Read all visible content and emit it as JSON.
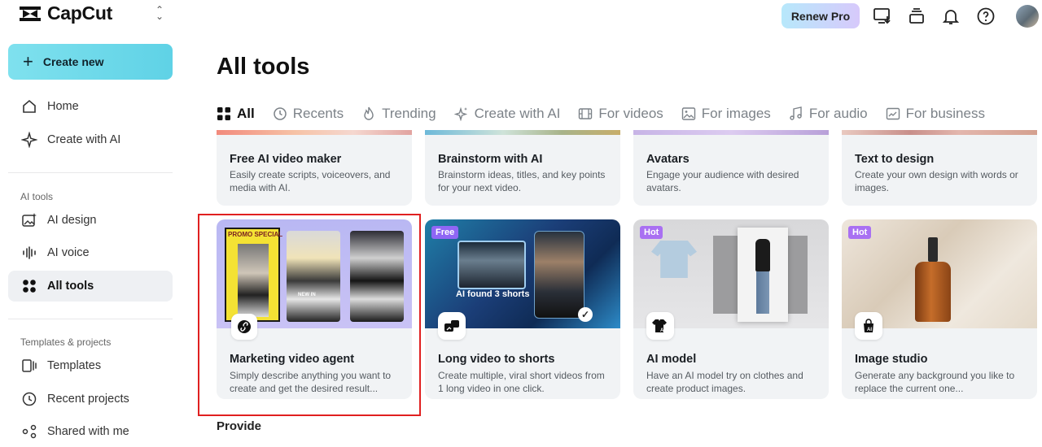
{
  "app": {
    "name": "CapCut"
  },
  "sidebar": {
    "create_label": "Create new",
    "nav": [
      {
        "label": "Home",
        "icon": "home-icon"
      },
      {
        "label": "Create with AI",
        "icon": "sparkle-icon"
      }
    ],
    "ai_tools_label": "AI tools",
    "ai_items": [
      {
        "label": "AI design",
        "icon": "image-sparkle-icon"
      },
      {
        "label": "AI voice",
        "icon": "waveform-icon"
      },
      {
        "label": "All tools",
        "icon": "grid-icon",
        "active": true
      }
    ],
    "templates_label": "Templates & projects",
    "project_items": [
      {
        "label": "Templates",
        "icon": "template-icon"
      },
      {
        "label": "Recent projects",
        "icon": "clock-icon"
      },
      {
        "label": "Shared with me",
        "icon": "share-icon"
      }
    ]
  },
  "topbar": {
    "renew_label": "Renew Pro"
  },
  "main": {
    "title": "All tools",
    "tabs": [
      {
        "label": "All",
        "icon": "grid-icon",
        "active": true
      },
      {
        "label": "Recents",
        "icon": "clock-icon"
      },
      {
        "label": "Trending",
        "icon": "flame-icon"
      },
      {
        "label": "Create with AI",
        "icon": "sparkle-icon"
      },
      {
        "label": "For videos",
        "icon": "film-icon"
      },
      {
        "label": "For images",
        "icon": "image-icon"
      },
      {
        "label": "For audio",
        "icon": "music-icon"
      },
      {
        "label": "For business",
        "icon": "chart-icon"
      }
    ],
    "row1": [
      {
        "title": "Free AI video maker",
        "desc": "Easily create scripts, voiceovers, and media with AI."
      },
      {
        "title": "Brainstorm with AI",
        "desc": "Brainstorm ideas, titles, and key points for your next video."
      },
      {
        "title": "Avatars",
        "desc": "Engage your audience with desired avatars."
      },
      {
        "title": "Text to design",
        "desc": "Create your own design with words or images."
      }
    ],
    "row2": [
      {
        "title": "Marketing video agent",
        "desc": "Simply describe anything you want to create and get the desired result...",
        "thumb_texts": [
          "PROMO SPECIAL",
          "NEW IN"
        ]
      },
      {
        "title": "Long video to shorts",
        "desc": "Create multiple, viral short videos from 1 long video in one click.",
        "badge": "Free",
        "thumb_text": "AI found 3 shorts"
      },
      {
        "title": "AI model",
        "desc": "Have an AI model try on clothes and create product images.",
        "badge": "Hot"
      },
      {
        "title": "Image studio",
        "desc": "Generate any background you like to replace the current one...",
        "badge": "Hot"
      }
    ],
    "next_section": "Provide"
  }
}
